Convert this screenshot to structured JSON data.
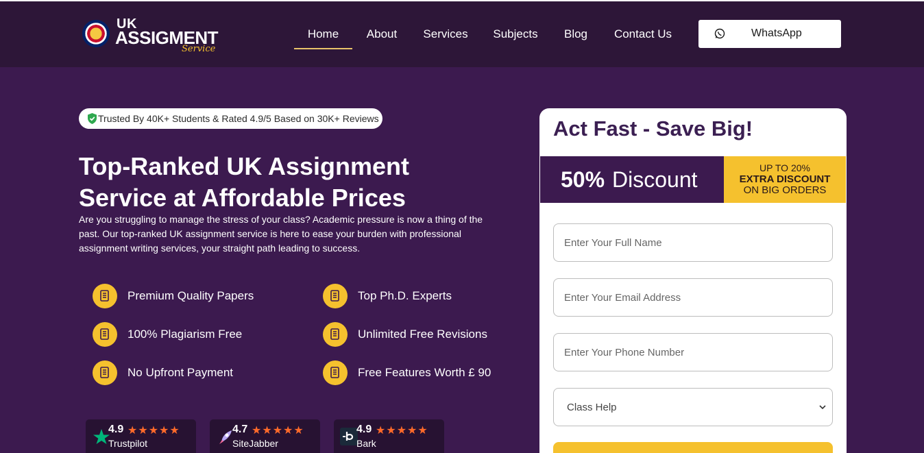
{
  "brand": {
    "line1": "UK",
    "line2": "ASSIGMENT",
    "line3": "Service"
  },
  "nav": {
    "items": [
      {
        "label": "Home",
        "active": true
      },
      {
        "label": "About"
      },
      {
        "label": "Services"
      },
      {
        "label": "Subjects"
      },
      {
        "label": "Blog"
      },
      {
        "label": "Contact Us"
      }
    ]
  },
  "whatsapp": {
    "label": "WhatsApp",
    "icon": "whatsapp-icon"
  },
  "hero": {
    "trust_badge": "Trusted By 40K+ Students & Rated 4.9/5 Based on 30K+ Reviews",
    "title_line1": "Top-Ranked UK Assignment",
    "title_line2": "Service at Affordable Prices",
    "description": "Are you struggling to manage the stress of your class? Academic pressure is now a thing of the past. Our top-ranked UK assignment service is here to ease your burden with professional assignment writing services, your straight path leading to success."
  },
  "features": [
    "Premium Quality Papers",
    "Top Ph.D. Experts",
    "100% Plagiarism Free",
    "Unlimited Free Revisions",
    "No Upfront Payment",
    "Free Features Worth £ 90"
  ],
  "reviews": [
    {
      "score": "4.9",
      "name": "Trustpilot",
      "stars": 5,
      "icon": "trustpilot-star-icon"
    },
    {
      "score": "4.7",
      "name": "SiteJabber",
      "stars": 5,
      "icon": "sitejabber-rocket-icon"
    },
    {
      "score": "4.9",
      "name": "Bark",
      "stars": 5,
      "icon": "bark-logo-icon"
    }
  ],
  "form": {
    "title": "Act Fast - Save Big!",
    "discount_pct": "50%",
    "discount_word": "Discount",
    "extra_line1": "UP TO 20%",
    "extra_line2": "EXTRA DISCOUNT",
    "extra_line3": "ON BIG ORDERS",
    "name_placeholder": "Enter Your Full Name",
    "email_placeholder": "Enter Your Email Address",
    "phone_placeholder": "Enter Your Phone Number",
    "service_selected": "Class Help"
  },
  "colors": {
    "header_bg": "#2d1638",
    "hero_bg": "#3c1a4f",
    "accent_yellow": "#f5c12e",
    "star_orange": "#ff6a2a"
  }
}
